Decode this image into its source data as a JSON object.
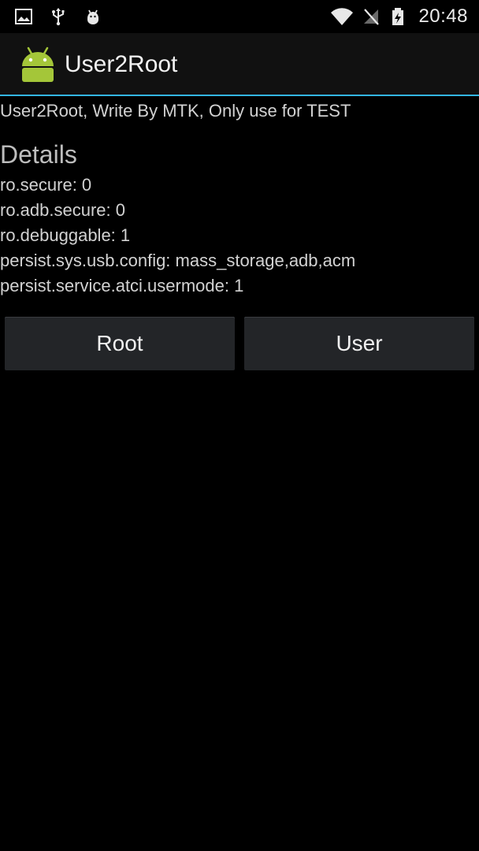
{
  "status_bar": {
    "time": "20:48",
    "left_icons": [
      "gallery-icon",
      "usb-icon",
      "android-debug-icon"
    ],
    "right_icons": [
      "wifi-icon",
      "no-signal-icon",
      "battery-icon"
    ]
  },
  "app": {
    "title": "User2Root",
    "icon": "android-robot-icon",
    "accent_color": "#33b5e5"
  },
  "content": {
    "subtitle": "User2Root, Write By MTK, Only use for TEST",
    "details_heading": "Details",
    "properties": [
      "ro.secure: 0",
      "ro.adb.secure: 0",
      "ro.debuggable: 1",
      "persist.sys.usb.config: mass_storage,adb,acm",
      "persist.service.atci.usermode: 1"
    ]
  },
  "buttons": {
    "root_label": "Root",
    "user_label": "User"
  }
}
